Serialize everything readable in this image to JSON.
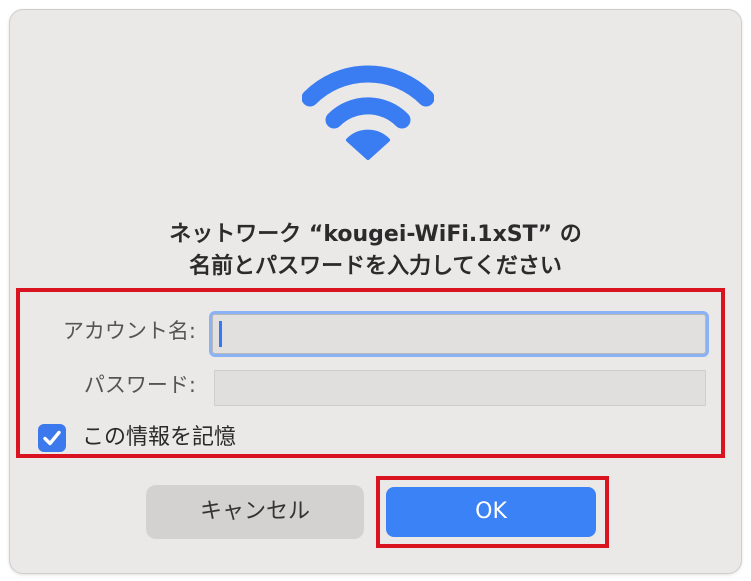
{
  "dialog": {
    "title_line1": "ネットワーク “kougei-WiFi.1xST” の",
    "title_line2": "名前とパスワードを入力してください",
    "icon": "wifi-icon"
  },
  "form": {
    "account_label": "アカウント名:",
    "account_value": "",
    "password_label": "パスワード:",
    "password_value": "",
    "remember_label": "この情報を記憶",
    "remember_checked": true
  },
  "buttons": {
    "cancel_label": "キャンセル",
    "ok_label": "OK"
  },
  "colors": {
    "accent": "#3b82f6",
    "highlight": "#d9131f",
    "dialog_bg": "#ebe9e8"
  }
}
